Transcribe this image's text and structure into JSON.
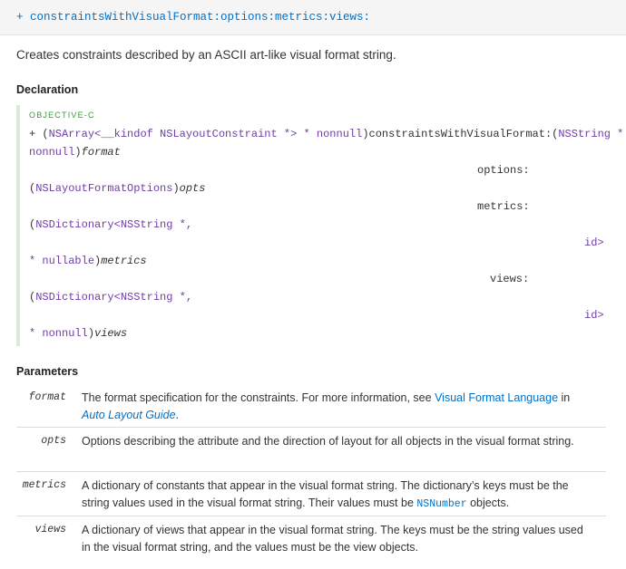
{
  "header": {
    "method_signature": "+ constraintsWithVisualFormat:options:metrics:views:"
  },
  "abstract": "Creates constraints described by an ASCII art-like visual format string.",
  "declaration": {
    "heading": "Declaration",
    "language": "OBJECTIVE-C",
    "lines": {
      "l1_plus": "+ (",
      "l1_type1": "NSArray",
      "l1_lt": "<",
      "l1_kindof": "__kindof",
      "l1_type2": " NSLayoutConstraint",
      "l1_star": " *",
      "l1_gt": "> * ",
      "l1_nonnull": "nonnull",
      "l1_paren": ")",
      "l1_selector": "constraintsWithVisualFormat:",
      "l1_open": "(",
      "l1_nsstring": "NSString",
      "l1_star2": " *",
      "l2_nonnull": "nonnull",
      "l2_paren": ")",
      "l2_param": "format",
      "options_label": "options:",
      "opts_open": "(",
      "opts_type": "NSLayoutFormatOptions",
      "opts_close": ")",
      "opts_param": "opts",
      "metrics_label": "metrics:",
      "metrics_open": "(",
      "metrics_type1": "NSDictionary",
      "metrics_lt": "<",
      "metrics_type2": "NSString",
      "metrics_rest": " *,",
      "metrics_id": "id>",
      "metrics_star": "* ",
      "metrics_nullable": "nullable",
      "metrics_close": ")",
      "metrics_param": "metrics",
      "views_label": "views:",
      "views_open": "(",
      "views_type1": "NSDictionary",
      "views_lt": "<",
      "views_type2": "NSString",
      "views_rest": " *,",
      "views_id": "id>",
      "views_star": "* ",
      "views_nonnull": "nonnull",
      "views_close": ")",
      "views_param": "views"
    }
  },
  "parameters": {
    "heading": "Parameters",
    "rows": [
      {
        "name": "format",
        "desc_a": "The format specification for the constraints. For more information, see ",
        "link1": "Visual Format Language",
        "desc_b": " in ",
        "link2": "Auto Layout Guide",
        "desc_c": "."
      },
      {
        "name": "opts",
        "desc_a": "Options describing the attribute and the direction of layout for all objects in the visual format string."
      },
      {
        "name": "metrics",
        "desc_a": "A dictionary of constants that appear in the visual format string. The dictionary’s keys must be the string values used in the visual format string. Their values must be ",
        "code": "NSNumber",
        "desc_b": " objects."
      },
      {
        "name": "views",
        "desc_a": "A dictionary of views that appear in the visual format string. The keys must be the string values used in the visual format string, and the values must be the view objects."
      }
    ]
  },
  "colors": {
    "link": "#0070c9",
    "type": "#703daa",
    "language": "#3a9a3a",
    "decl_bar": "#d9ebd5"
  }
}
